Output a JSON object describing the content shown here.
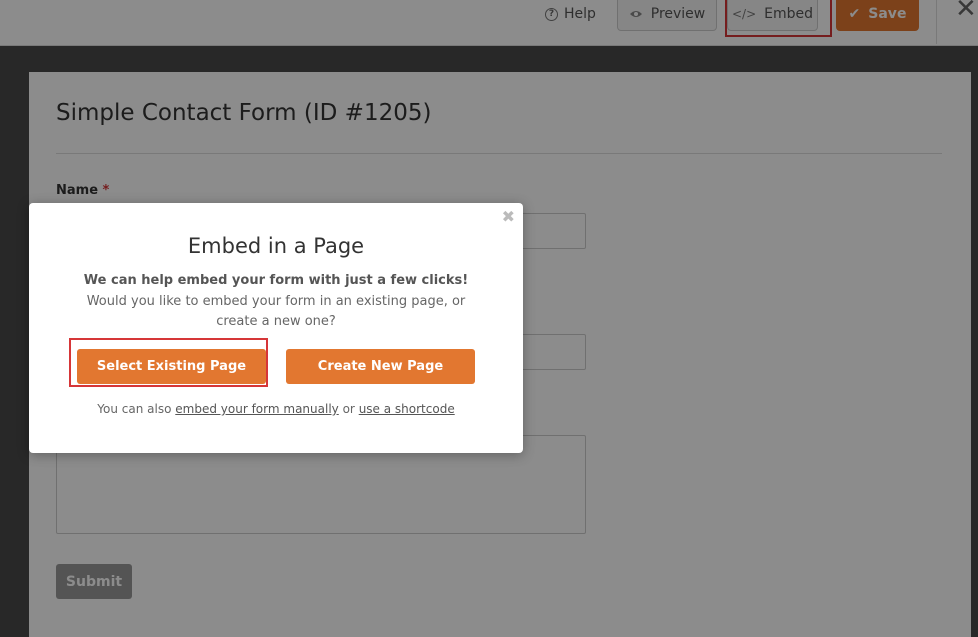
{
  "toolbar": {
    "help_label": "Help",
    "preview_label": "Preview",
    "embed_label": "Embed",
    "save_label": "Save"
  },
  "form": {
    "title": "Simple Contact Form (ID #1205)",
    "name_label": "Name",
    "required_mark": "*",
    "submit_label": "Submit"
  },
  "modal": {
    "title": "Embed in a Page",
    "lead": "We can help embed your form with just a few clicks!",
    "description": "Would you like to embed your form in an existing page, or create a new one?",
    "select_existing_label": "Select Existing Page",
    "create_new_label": "Create New Page",
    "footer_prefix": "You can also",
    "footer_link_manual": "embed your form manually",
    "footer_or": "or",
    "footer_link_shortcode": "use a shortcode"
  },
  "colors": {
    "accent": "#e27730",
    "highlight": "#d63638"
  }
}
